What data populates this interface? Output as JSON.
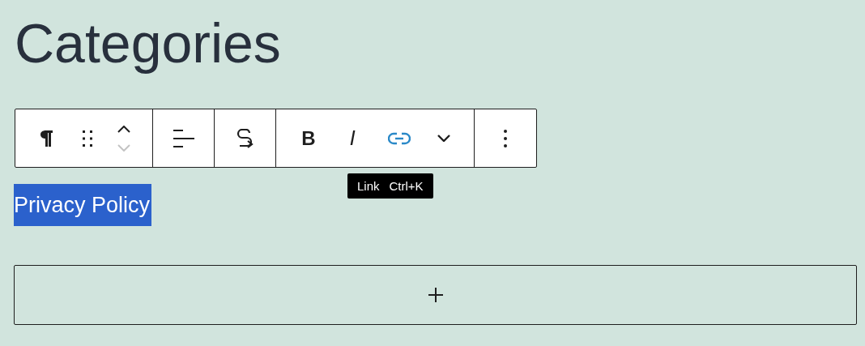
{
  "heading": "Categories",
  "toolbar": [
    {
      "items": [
        {
          "kind": "paragraph"
        },
        {
          "kind": "drag"
        },
        {
          "kind": "mover",
          "up_disabled": false,
          "down_disabled": true
        }
      ]
    },
    {
      "items": [
        {
          "kind": "align"
        }
      ]
    },
    {
      "items": [
        {
          "kind": "transform"
        }
      ]
    },
    {
      "items": [
        {
          "kind": "bold",
          "label": "B",
          "selected": false
        },
        {
          "kind": "italic",
          "label": "I",
          "selected": false
        },
        {
          "kind": "link",
          "selected": true
        },
        {
          "kind": "more"
        }
      ]
    },
    {
      "items": [
        {
          "kind": "options"
        }
      ]
    }
  ],
  "tooltip": {
    "label": "Link",
    "shortcut": "Ctrl+K"
  },
  "selected_text": "Privacy Policy",
  "add_block": {
    "kind": "plus"
  }
}
